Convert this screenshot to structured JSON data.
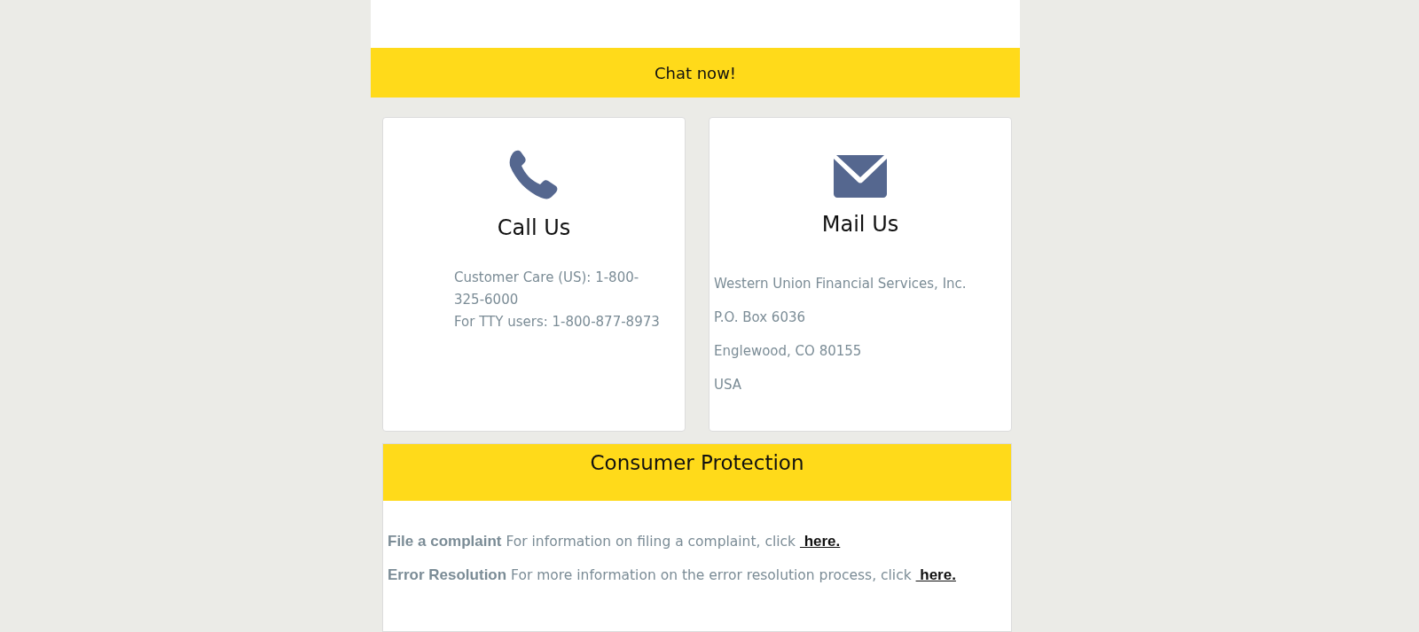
{
  "chat_button": {
    "label": "Chat now!"
  },
  "contact_cards": [
    {
      "kind": "phone",
      "title": "Call Us",
      "lines": [
        "Customer Care (US): 1-800-325-6000",
        "For TTY users: 1-800-877-8973"
      ]
    },
    {
      "kind": "mail",
      "title": "Mail Us",
      "lines": [
        "Western Union Financial Services, Inc.",
        "P.O. Box 6036",
        "Englewood, CO 80155",
        "USA"
      ]
    }
  ],
  "consumer_protection": {
    "title": "Consumer Protection",
    "items": [
      {
        "label": "File a complaint",
        "text": "For information on filing a complaint, click",
        "link": " here."
      },
      {
        "label": "Error Resolution",
        "text": "For more information on the error resolution process, click",
        "link": " here."
      }
    ]
  }
}
